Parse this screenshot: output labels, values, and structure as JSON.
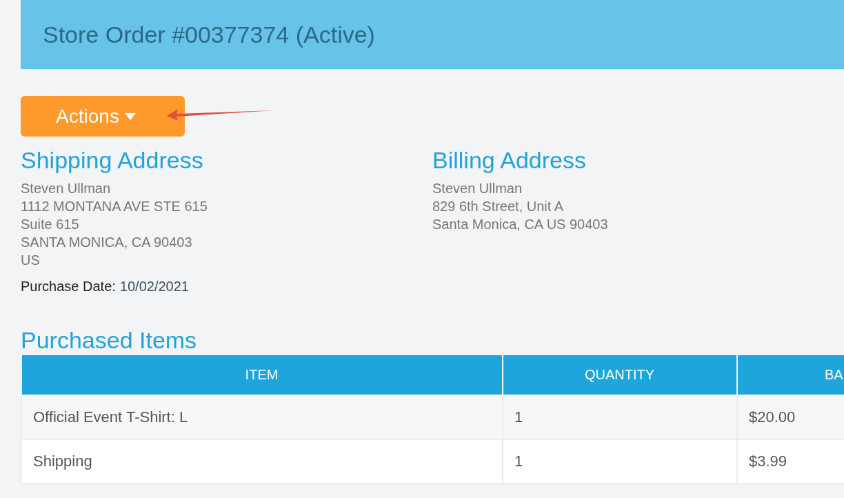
{
  "header": {
    "title": "Store Order #00377374 (Active)"
  },
  "actions_button": {
    "label": "Actions",
    "annotated": true
  },
  "shipping_address": {
    "heading": "Shipping Address",
    "lines": [
      "Steven Ullman",
      "1112 MONTANA AVE STE 615",
      "Suite 615",
      "SANTA MONICA, CA 90403",
      "US"
    ]
  },
  "billing_address": {
    "heading": "Billing Address",
    "lines": [
      "Steven Ullman",
      "829 6th Street, Unit A",
      "Santa Monica, CA US 90403"
    ]
  },
  "purchase_date": {
    "label": "Purchase Date:",
    "value": "10/02/2021"
  },
  "purchased_items": {
    "heading": "Purchased Items",
    "columns": [
      "ITEM",
      "QUANTITY",
      "BA"
    ],
    "rows": [
      {
        "cells": [
          "Official Event T-Shirt: L",
          "1",
          "$20.00"
        ]
      },
      {
        "cells": [
          "Shipping",
          "1",
          "$3.99"
        ]
      }
    ]
  }
}
